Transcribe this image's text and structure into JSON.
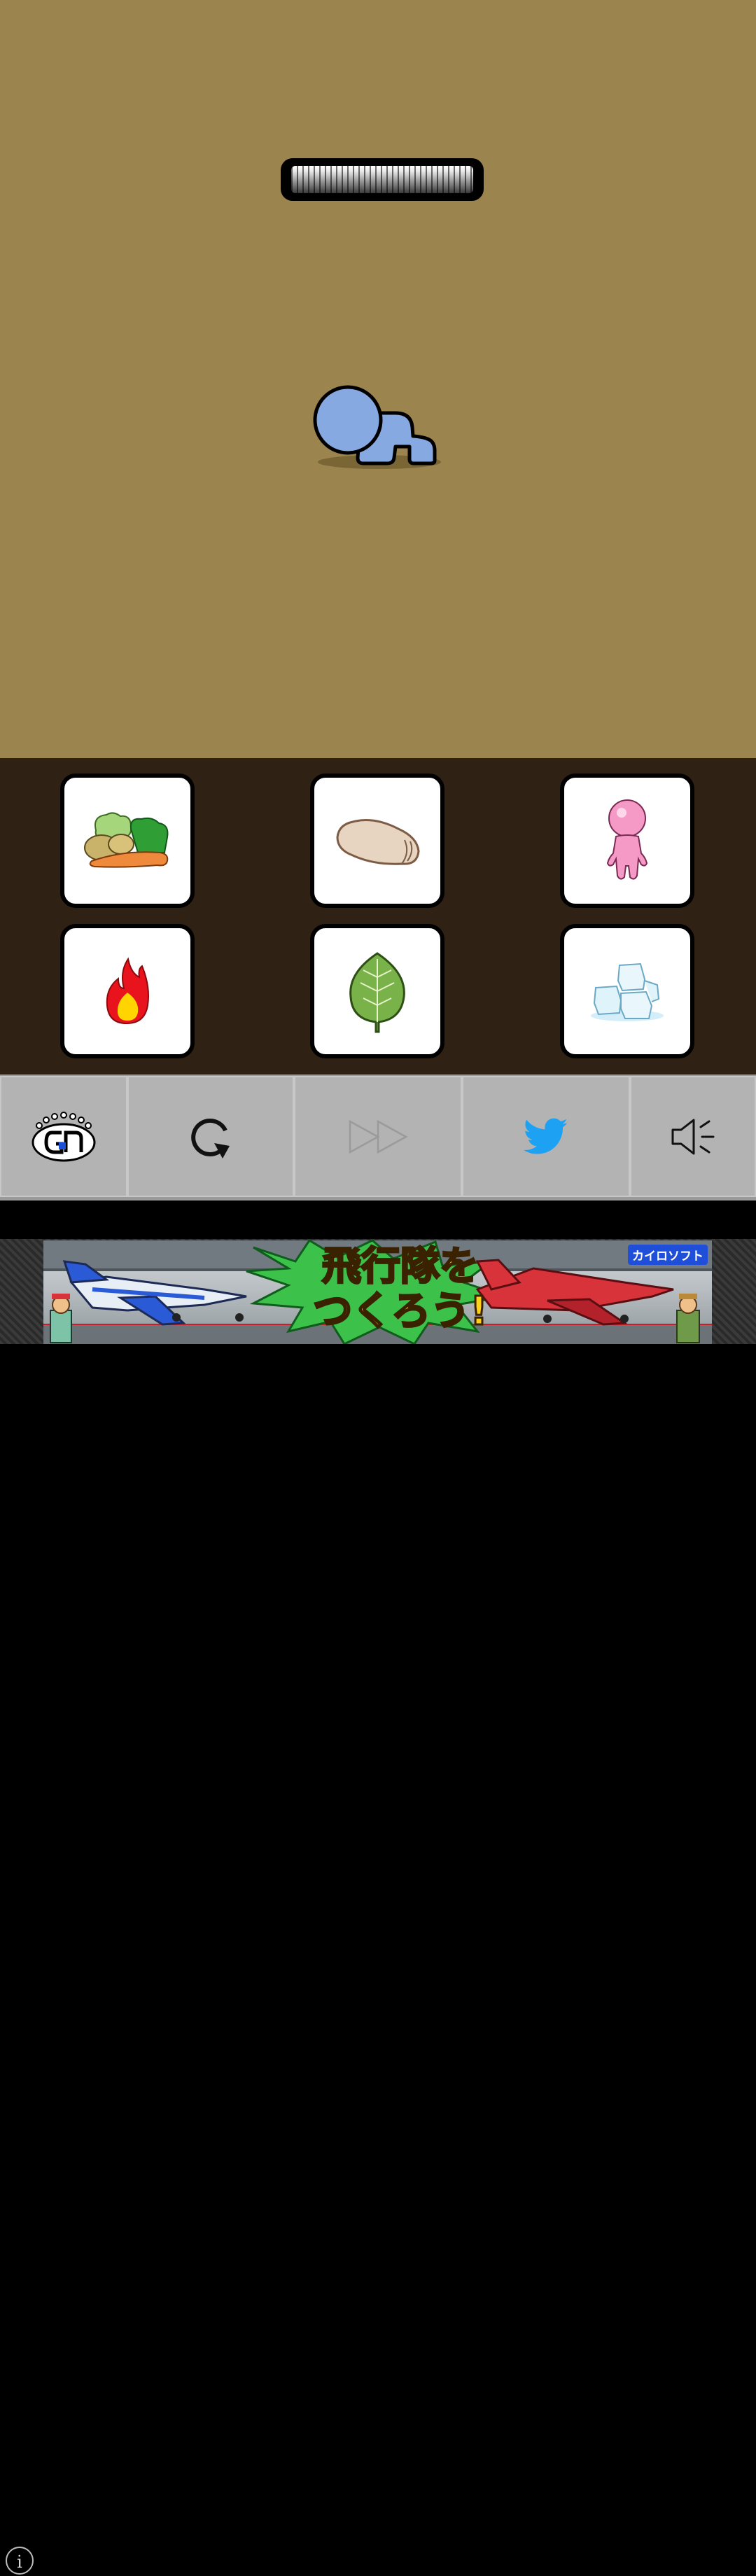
{
  "game": {
    "stage_color": "#9b844d",
    "tray_color": "#302115",
    "character": "crawling-baby",
    "meter_level": 1.0,
    "items": [
      "vegetables",
      "towel",
      "doll",
      "fire",
      "leaf",
      "ice"
    ]
  },
  "toolbar": {
    "buttons": [
      "logo",
      "retry",
      "fast-forward",
      "twitter",
      "sound"
    ],
    "twitter_color": "#1da1f2"
  },
  "ad": {
    "title_line1": "飛行隊を",
    "title_line2": "つくろう!",
    "brand": "カイロソフト",
    "info_label": "i"
  }
}
